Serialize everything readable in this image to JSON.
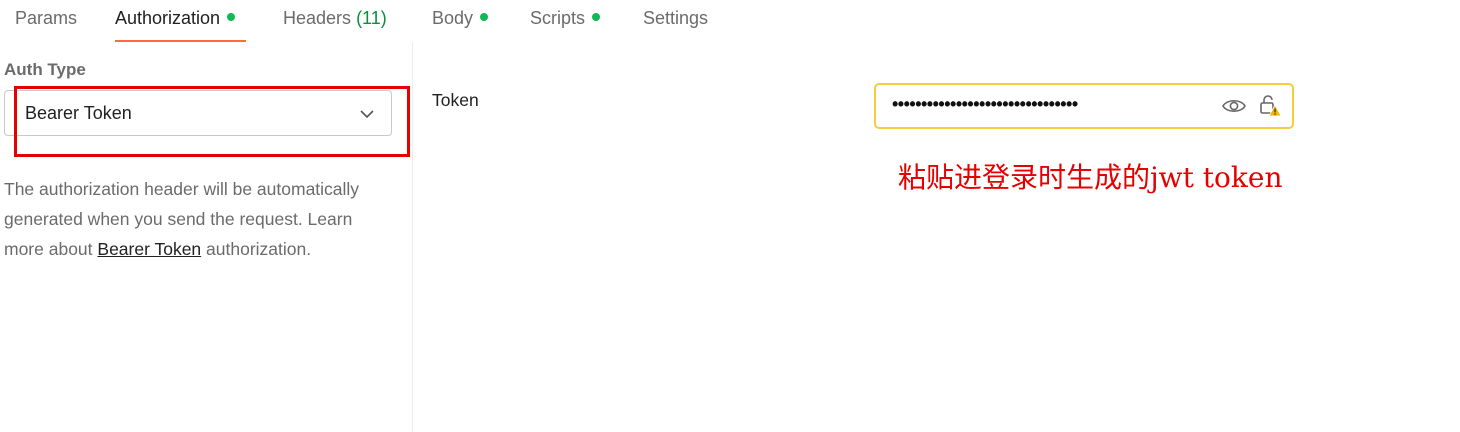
{
  "tabs": [
    {
      "label": "Params"
    },
    {
      "label": "Authorization"
    },
    {
      "label": "Headers",
      "count": "(11)"
    },
    {
      "label": "Body"
    },
    {
      "label": "Scripts"
    },
    {
      "label": "Settings"
    }
  ],
  "auth": {
    "type_label": "Auth Type",
    "selected": "Bearer Token",
    "description_pre": "The authorization header will be automatically generated when you send the request. Learn more about ",
    "description_link": "Bearer Token",
    "description_post": " authorization."
  },
  "token": {
    "label": "Token",
    "masked_value": "••••••••••••••••••••••••••••••••"
  },
  "annotation": "粘贴进登录时生成的jwt token",
  "colors": {
    "accent": "#ff6c37",
    "dot": "#0cbb52",
    "field_border": "#f5cd3f",
    "annotation": "#e60000"
  }
}
